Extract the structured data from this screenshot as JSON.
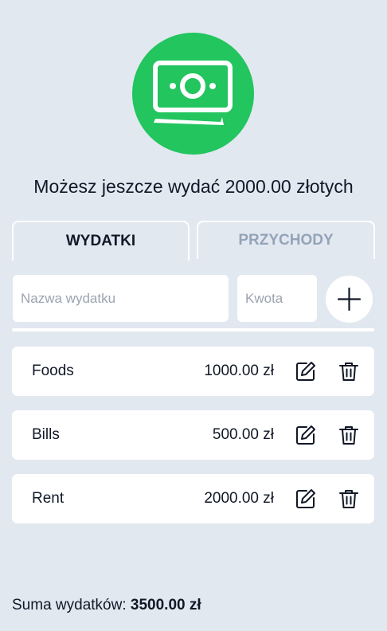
{
  "header": {
    "logo_icon": "money-bill-icon",
    "budget_message": "Możesz jeszcze wydać 2000.00 złotych"
  },
  "tabs": [
    {
      "label": "WYDATKI",
      "active": true
    },
    {
      "label": "PRZYCHODY",
      "active": false
    }
  ],
  "form": {
    "name_placeholder": "Nazwa wydatku",
    "amount_placeholder": "Kwota",
    "add_icon": "plus-icon"
  },
  "expenses": [
    {
      "name": "Foods",
      "amount": "1000.00 zł"
    },
    {
      "name": "Bills",
      "amount": "500.00 zł"
    },
    {
      "name": "Rent",
      "amount": "2000.00 zł"
    }
  ],
  "footer": {
    "total_label": "Suma wydatków:",
    "total_value": "3500.00 zł"
  },
  "colors": {
    "background": "#e2e8f0",
    "accent_green": "#22c55e",
    "inactive_tab_text": "#94a3b8"
  }
}
